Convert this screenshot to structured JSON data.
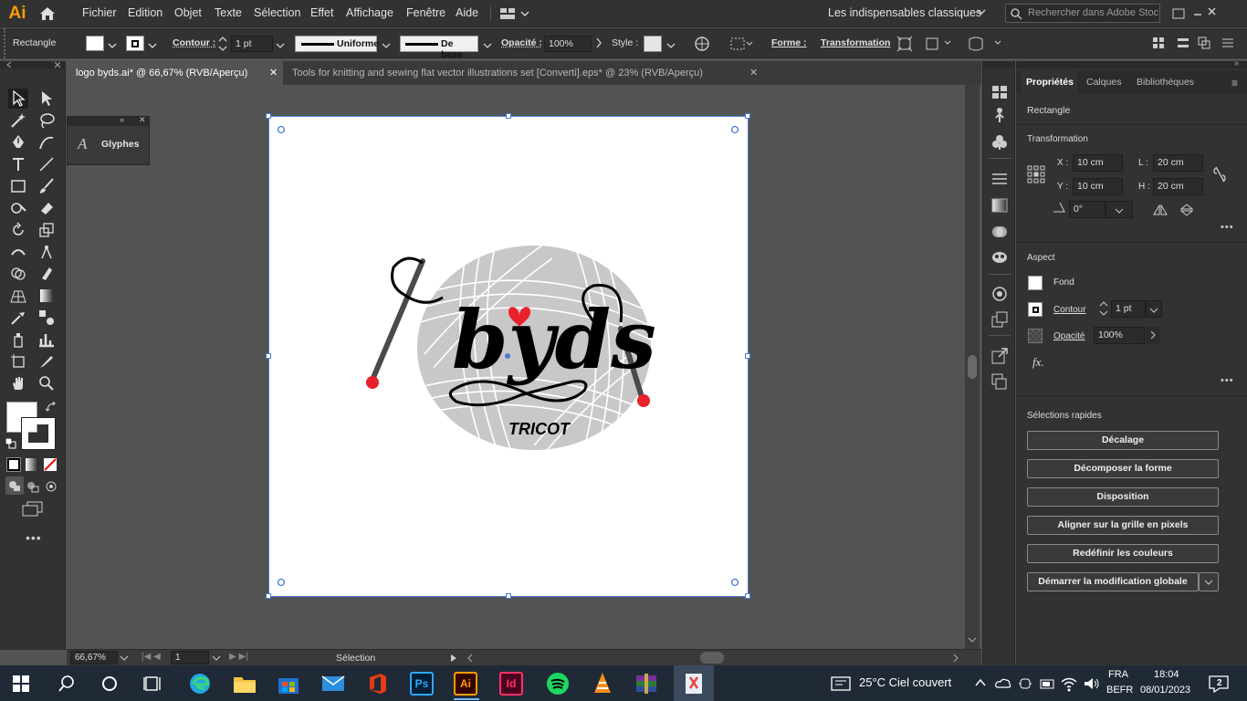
{
  "app": {
    "logo": "Ai"
  },
  "menu": {
    "items": [
      "Fichier",
      "Edition",
      "Objet",
      "Texte",
      "Sélection",
      "Effet",
      "Affichage",
      "Fenêtre",
      "Aide"
    ],
    "workspace": "Les indispensables classiques",
    "search_placeholder": "Rechercher dans Adobe Stock"
  },
  "control": {
    "object_type": "Rectangle",
    "contour_label": "Contour :",
    "contour_value": "1 pt",
    "stroke_profile": "Uniforme",
    "brush": "De base",
    "opacity_label": "Opacité :",
    "opacity_value": "100%",
    "style_label": "Style :",
    "forme_label": "Forme :",
    "transformation_label": "Transformation"
  },
  "tabs": [
    {
      "label": "logo byds.ai* @ 66,67% (RVB/Aperçu)",
      "active": true
    },
    {
      "label": "Tools for knitting and sewing flat vector illustrations set [Converti].eps* @ 23% (RVB/Aperçu)",
      "active": false
    }
  ],
  "floating_panel": {
    "label": "Glyphes"
  },
  "artwork": {
    "brand": "byds",
    "subtitle": "TRICOT"
  },
  "status": {
    "zoom": "66,67%",
    "page": "1",
    "tool": "Sélection"
  },
  "panel": {
    "tabs": [
      "Propriétés",
      "Calques",
      "Bibliothèques"
    ],
    "object_type": "Rectangle",
    "transformation_title": "Transformation",
    "x_label": "X :",
    "x_value": "10 cm",
    "y_label": "Y :",
    "y_value": "10 cm",
    "l_label": "L :",
    "l_value": "20 cm",
    "h_label": "H :",
    "h_value": "20 cm",
    "angle_value": "0°",
    "aspect_title": "Aspect",
    "fond_label": "Fond",
    "contour_label": "Contour",
    "contour_value": "1 pt",
    "opacite_label": "Opacité",
    "opacite_value": "100%",
    "fx_label": "fx.",
    "quick_title": "Sélections rapides",
    "quick_actions": [
      "Décalage",
      "Décomposer la forme",
      "Disposition",
      "Aligner sur la grille en pixels",
      "Redéfinir les couleurs",
      "Démarrer la modification globale"
    ]
  },
  "taskbar": {
    "weather": "25°C  Ciel couvert",
    "lang1": "FRA",
    "lang2": "BEFR",
    "time": "18:04",
    "date": "08/01/2023",
    "notifications": "2"
  },
  "colors": {
    "accent": "#4a7bd4",
    "ui_dark": "#323232",
    "canvas": "#535353",
    "heart": "#e8212b",
    "yarn": "#c8c8c8"
  }
}
